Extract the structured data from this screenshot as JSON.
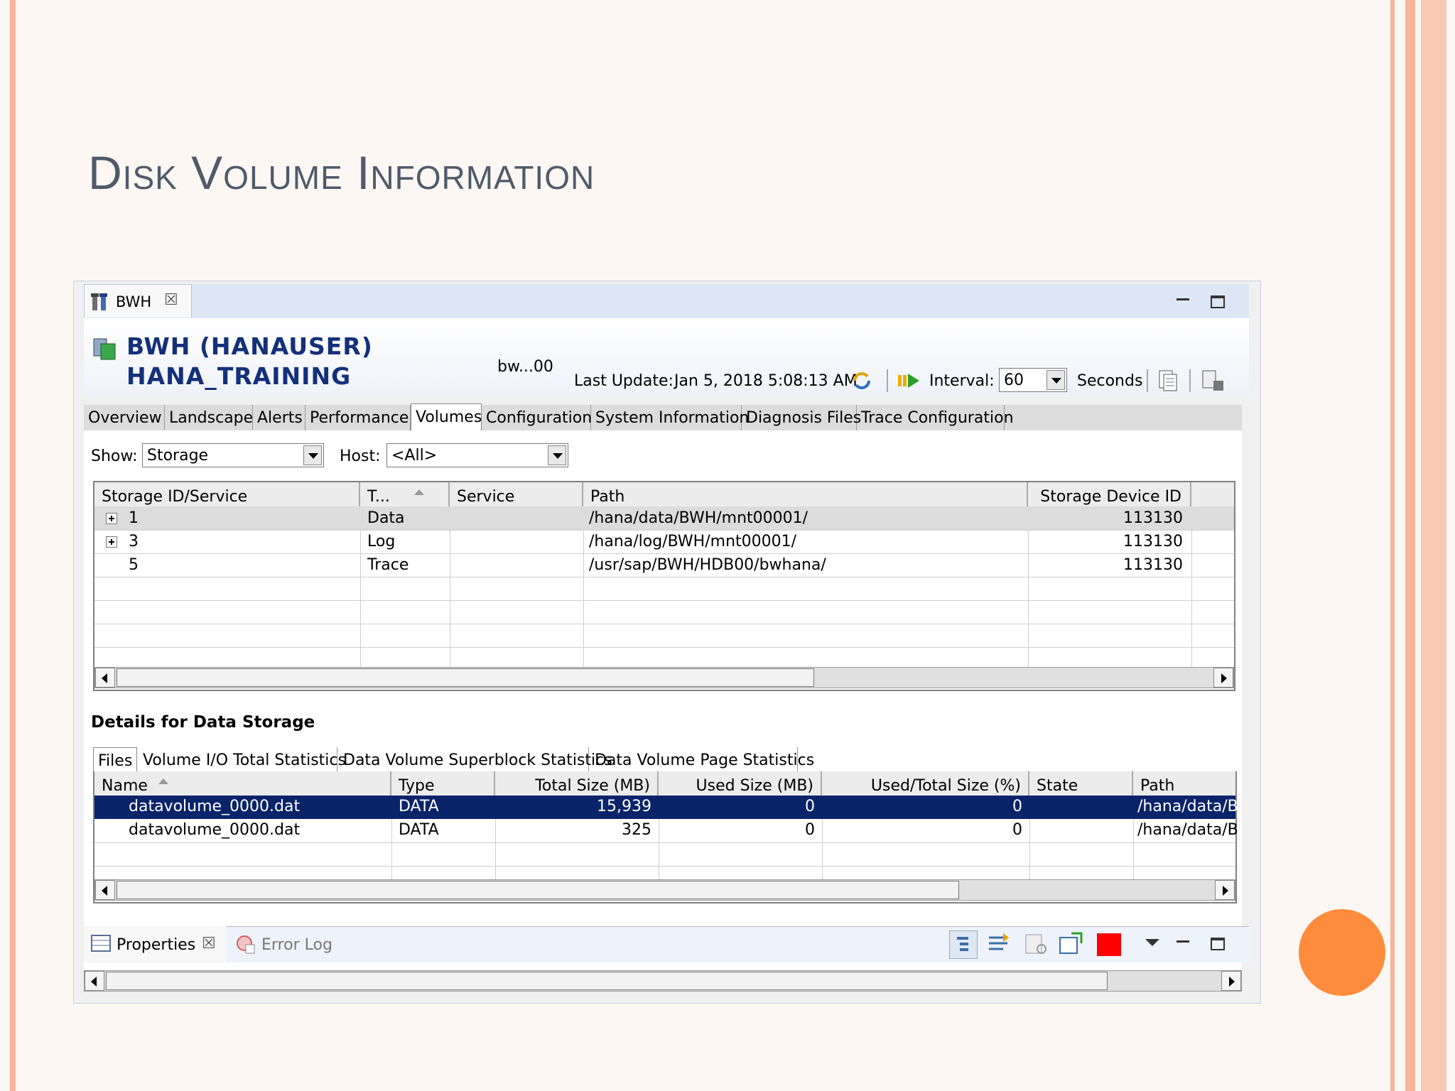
{
  "slide": {
    "title": "Disk Volume Information",
    "accent_color": "#ff8c3c",
    "stripe_color": "#f7b79a"
  },
  "editor_tab": {
    "label": "BWH",
    "icon": "db-admin-icon"
  },
  "header": {
    "system_line1": "BWH (HANAUSER)",
    "system_line2": "HANA_TRAINING",
    "host_short": "bw...00",
    "last_update_label": "Last Update:",
    "last_update_value": "Jan 5, 2018 5:08:13 AM",
    "interval_label": "Interval:",
    "interval_value": "60",
    "seconds_label": "Seconds"
  },
  "main_tabs": [
    "Overview",
    "Landscape",
    "Alerts",
    "Performance",
    "Volumes",
    "Configuration",
    "System Information",
    "Diagnosis Files",
    "Trace Configuration"
  ],
  "active_main_tab": "Volumes",
  "filters": {
    "show_label": "Show:",
    "show_value": "Storage",
    "host_label": "Host:",
    "host_value": "<All>"
  },
  "storage_table": {
    "columns": [
      "Storage ID/Service",
      "T...",
      "Service",
      "Path",
      "Storage Device ID"
    ],
    "rows": [
      {
        "id": "1",
        "type": "Data",
        "service": "",
        "path": "/hana/data/BWH/mnt00001/",
        "device_id": "113130"
      },
      {
        "id": "3",
        "type": "Log",
        "service": "",
        "path": "/hana/log/BWH/mnt00001/",
        "device_id": "113130"
      },
      {
        "id": "5",
        "type": "Trace",
        "service": "",
        "path": "/usr/sap/BWH/HDB00/bwhana/",
        "device_id": "113130"
      }
    ]
  },
  "details": {
    "heading": "Details for Data Storage",
    "tabs": [
      "Files",
      "Volume I/O Total Statistics",
      "Data Volume Superblock Statistics",
      "Data Volume Page Statistics"
    ],
    "columns": [
      "Name",
      "Type",
      "Total Size (MB)",
      "Used Size (MB)",
      "Used/Total Size (%)",
      "State",
      "Path"
    ],
    "rows": [
      {
        "name": "datavolume_0000.dat",
        "type": "DATA",
        "total": "15,939",
        "used": "0",
        "pct": "0",
        "state": "",
        "path": "/hana/data/B"
      },
      {
        "name": "datavolume_0000.dat",
        "type": "DATA",
        "total": "325",
        "used": "0",
        "pct": "0",
        "state": "",
        "path": "/hana/data/B"
      }
    ]
  },
  "bottom_panel": {
    "properties_label": "Properties",
    "error_log_label": "Error Log"
  }
}
